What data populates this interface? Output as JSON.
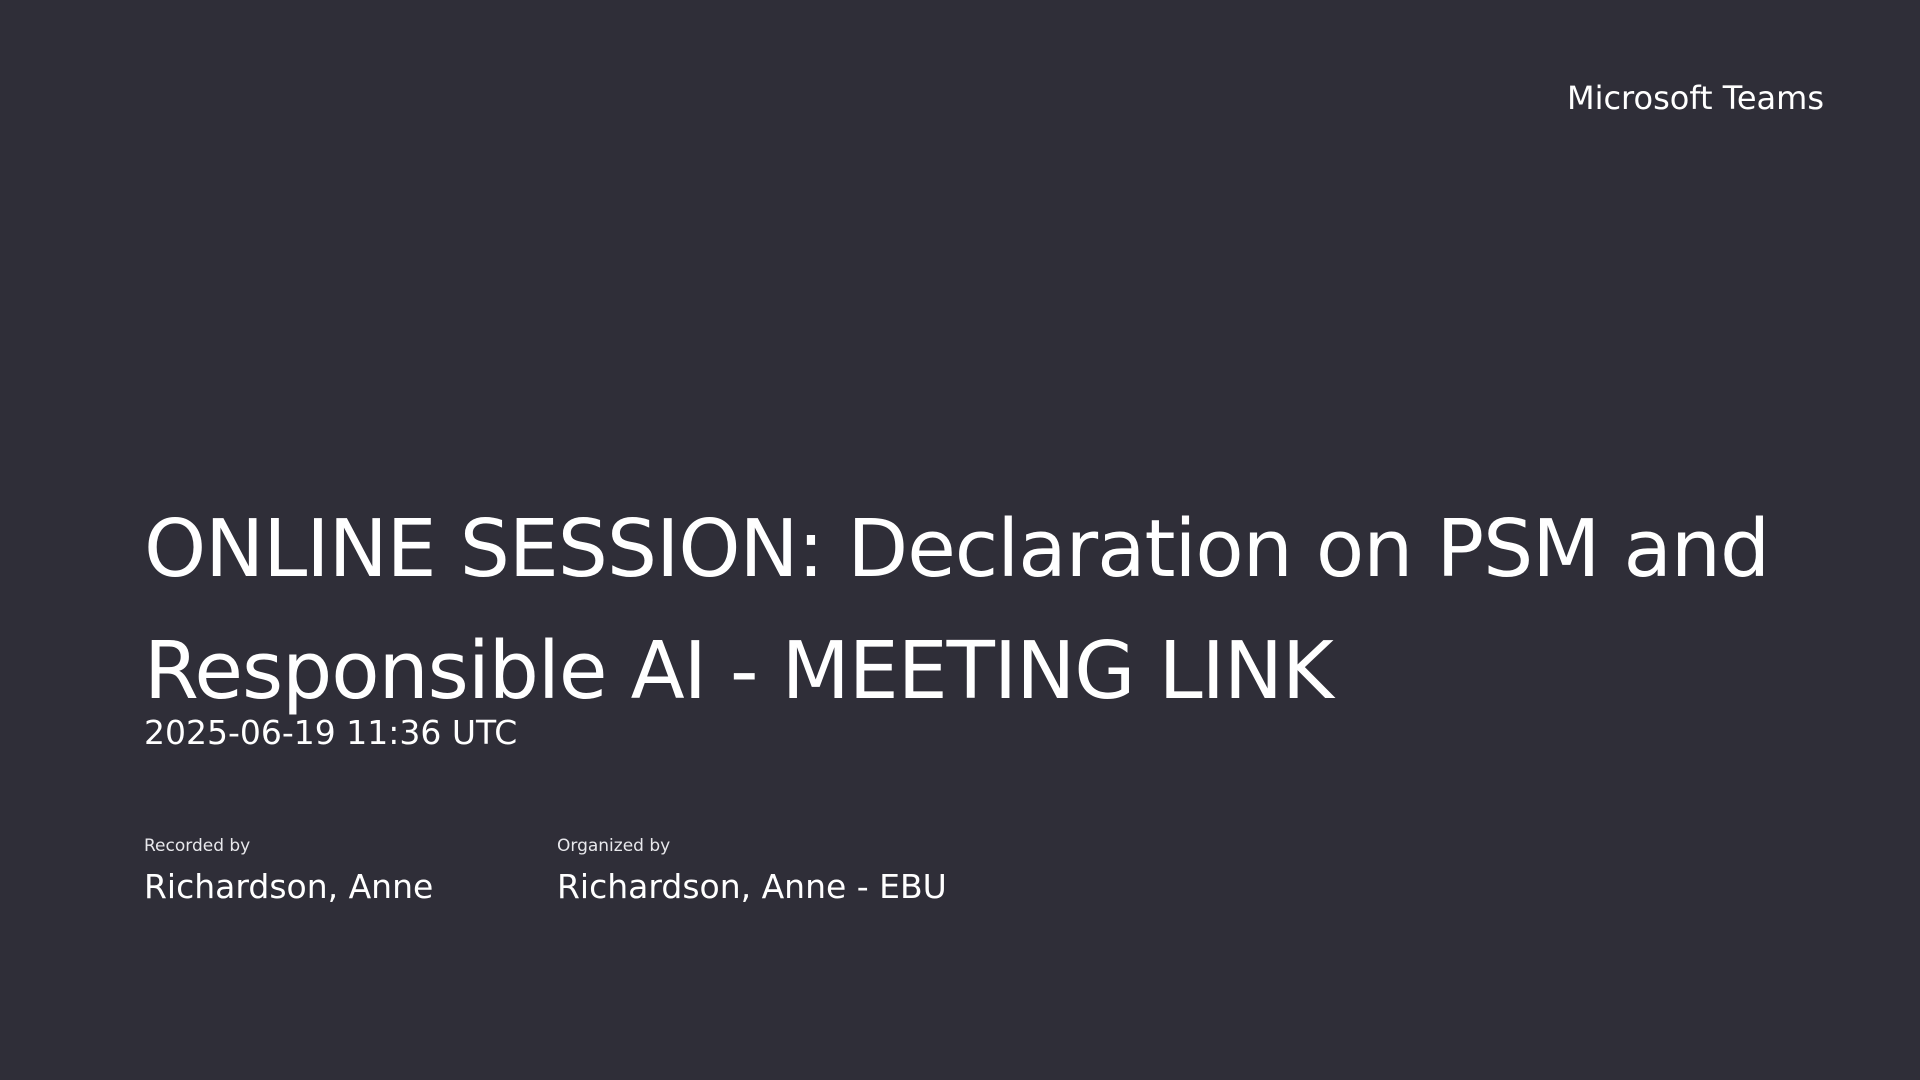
{
  "brand": {
    "name": "Microsoft Teams"
  },
  "recording": {
    "title": "ONLINE SESSION: Declaration on PSM and Responsible AI - MEETING LINK",
    "timestamp": "2025-06-19 11:36 UTC"
  },
  "meta": {
    "recorded_by_label": "Recorded by",
    "recorded_by_value": "Richardson, Anne",
    "organized_by_label": "Organized by",
    "organized_by_value": "Richardson, Anne - EBU"
  },
  "colors": {
    "background": "#2f2e38",
    "text": "#ffffff"
  }
}
